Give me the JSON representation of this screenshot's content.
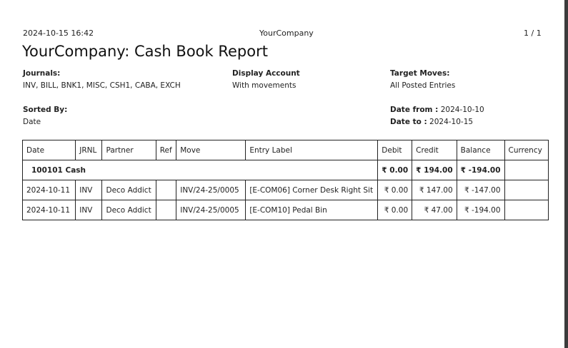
{
  "header": {
    "print_datetime": "2024-10-15 16:42",
    "company": "YourCompany",
    "page_counter": "1 / 1"
  },
  "title": "YourCompany: Cash Book Report",
  "filters": {
    "journals_label": "Journals:",
    "journals_value": "INV, BILL, BNK1, MISC, CSH1, CABA, EXCH",
    "display_account_label": "Display Account",
    "display_account_value": "With movements",
    "target_moves_label": "Target Moves:",
    "target_moves_value": "All Posted Entries",
    "sorted_by_label": "Sorted By:",
    "sorted_by_value": "Date",
    "date_from_label": "Date from :",
    "date_from_value": "2024-10-10",
    "date_to_label": "Date to :",
    "date_to_value": "2024-10-15"
  },
  "table": {
    "columns": [
      "Date",
      "JRNL",
      "Partner",
      "Ref",
      "Move",
      "Entry Label",
      "Debit",
      "Credit",
      "Balance",
      "Currency"
    ],
    "group": {
      "account": "100101 Cash",
      "debit": "₹ 0.00",
      "credit": "₹ 194.00",
      "balance": "₹ -194.00",
      "currency": ""
    },
    "rows": [
      {
        "date": "2024-10-11",
        "jrnl": "INV",
        "partner": "Deco Addict",
        "ref": "",
        "move": "INV/24-25/0005",
        "label": "[E-COM06] Corner Desk Right Sit",
        "debit": "₹ 0.00",
        "credit": "₹ 147.00",
        "balance": "₹ -147.00",
        "currency": ""
      },
      {
        "date": "2024-10-11",
        "jrnl": "INV",
        "partner": "Deco Addict",
        "ref": "",
        "move": "INV/24-25/0005",
        "label": "[E-COM10] Pedal Bin",
        "debit": "₹ 0.00",
        "credit": "₹ 47.00",
        "balance": "₹ -194.00",
        "currency": ""
      }
    ]
  }
}
